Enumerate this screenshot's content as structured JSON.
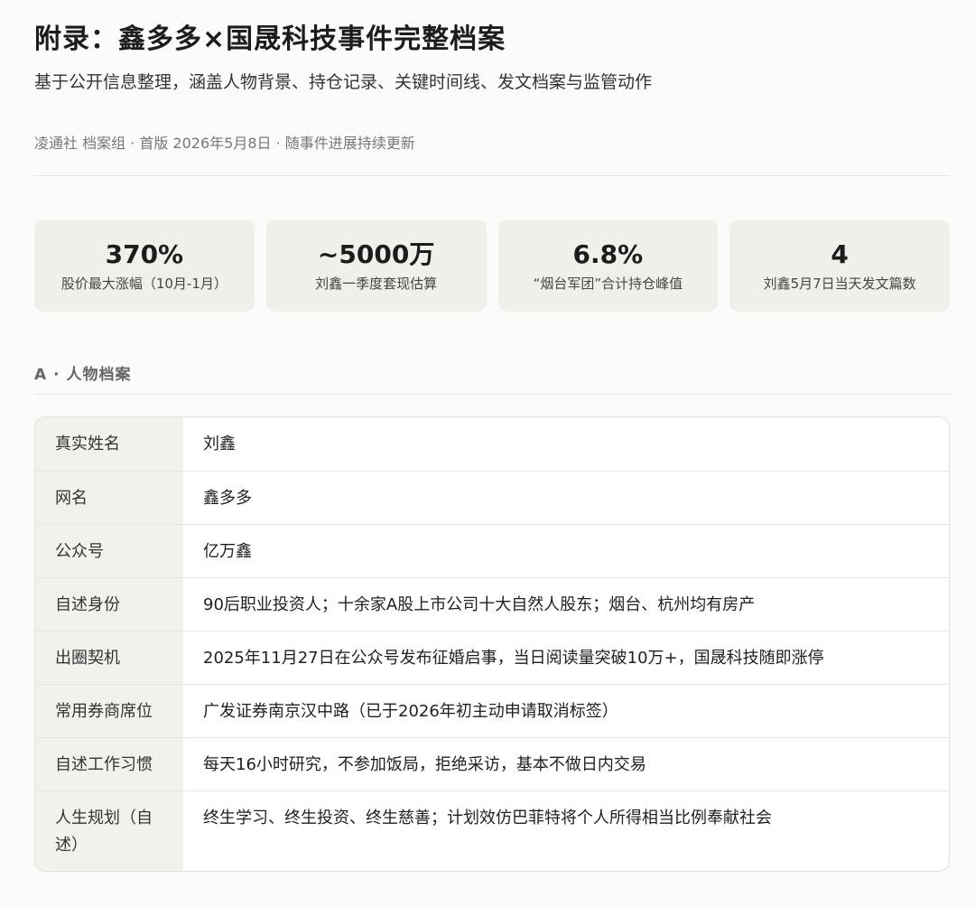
{
  "header": {
    "title": "附录：鑫多多×国晟科技事件完整档案",
    "subtitle": "基于公开信息整理，涵盖人物背景、持仓记录、关键时间线、发文档案与监管动作",
    "byline": "凌通社 档案组 · 首版 2026年5月8日 · 随事件进展持续更新"
  },
  "stats": [
    {
      "value": "370%",
      "label": "股价最大涨幅（10月-1月）"
    },
    {
      "value": "~5000万",
      "label": "刘鑫一季度套现估算"
    },
    {
      "value": "6.8%",
      "label": "“烟台军团”合计持仓峰值"
    },
    {
      "value": "4",
      "label": "刘鑫5月7日当天发文篇数"
    }
  ],
  "section_a": {
    "title": "A · 人物档案",
    "rows": [
      {
        "key": "真实姓名",
        "value": "刘鑫"
      },
      {
        "key": "网名",
        "value": "鑫多多"
      },
      {
        "key": "公众号",
        "value": "亿万鑫"
      },
      {
        "key": "自述身份",
        "value": "90后职业投资人；十余家A股上市公司十大自然人股东；烟台、杭州均有房产"
      },
      {
        "key": "出圈契机",
        "value": "2025年11月27日在公众号发布征婚启事，当日阅读量突破10万+，国晟科技随即涨停"
      },
      {
        "key": "常用券商席位",
        "value": "广发证券南京汉中路（已于2026年初主动申请取消标签）"
      },
      {
        "key": "自述工作习惯",
        "value": "每天16小时研究，不参加饭局，拒绝采访，基本不做日内交易"
      },
      {
        "key": "人生规划（自述）",
        "value": "终生学习、终生投资、终生慈善；计划效仿巴菲特将个人所得相当比例奉献社会"
      }
    ]
  }
}
